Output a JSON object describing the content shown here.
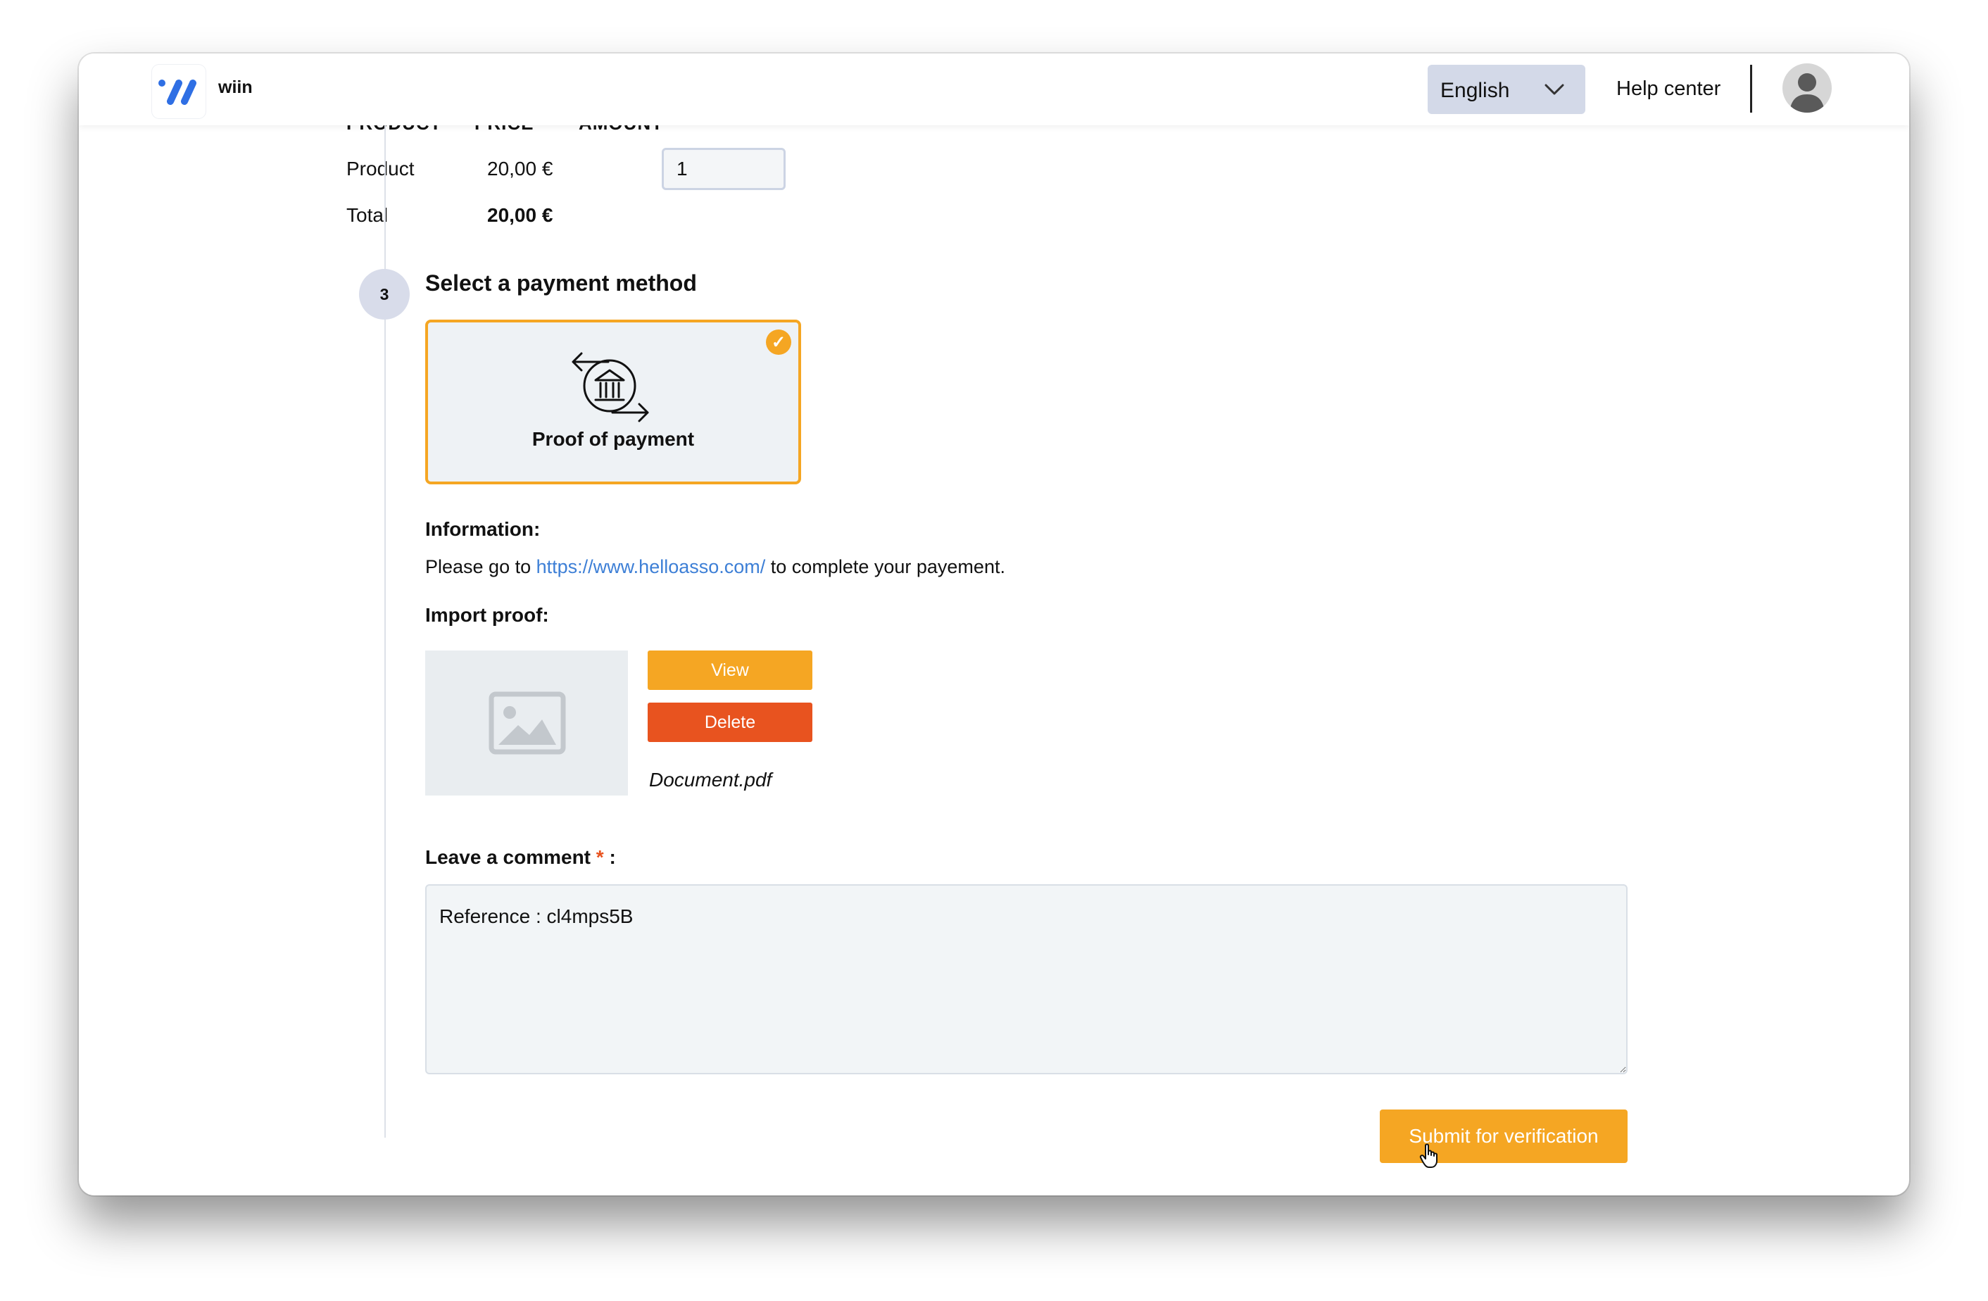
{
  "header": {
    "brand": "wiin",
    "language": "English",
    "help_center": "Help center"
  },
  "products": {
    "columns": [
      "PRODUCT",
      "PRICE",
      "AMOUNT"
    ],
    "row": {
      "name": "Product",
      "price": "20,00 €",
      "amount": "1"
    },
    "total": {
      "label": "Total",
      "value": "20,00 €"
    }
  },
  "step": {
    "number": "3",
    "title": "Select a payment method"
  },
  "payment_method": {
    "label": "Proof of payment",
    "selected": true
  },
  "information": {
    "label": "Information:",
    "text_before": "Please go to",
    "link": "https://www.helloasso.com/",
    "text_after": "to complete your payement."
  },
  "import_proof": {
    "label": "Import proof:",
    "view_label": "View",
    "delete_label": "Delete",
    "file_name": "Document.pdf"
  },
  "comment": {
    "label": "Leave a comment",
    "required_mark": "*",
    "suffix": ":",
    "value": "Reference : cl4mps5B"
  },
  "submit_label": "Submit for verification",
  "colors": {
    "accent": "#f5a623",
    "danger": "#e8531f",
    "link": "#3d7fd6",
    "brand_blue": "#2f6fe4"
  }
}
